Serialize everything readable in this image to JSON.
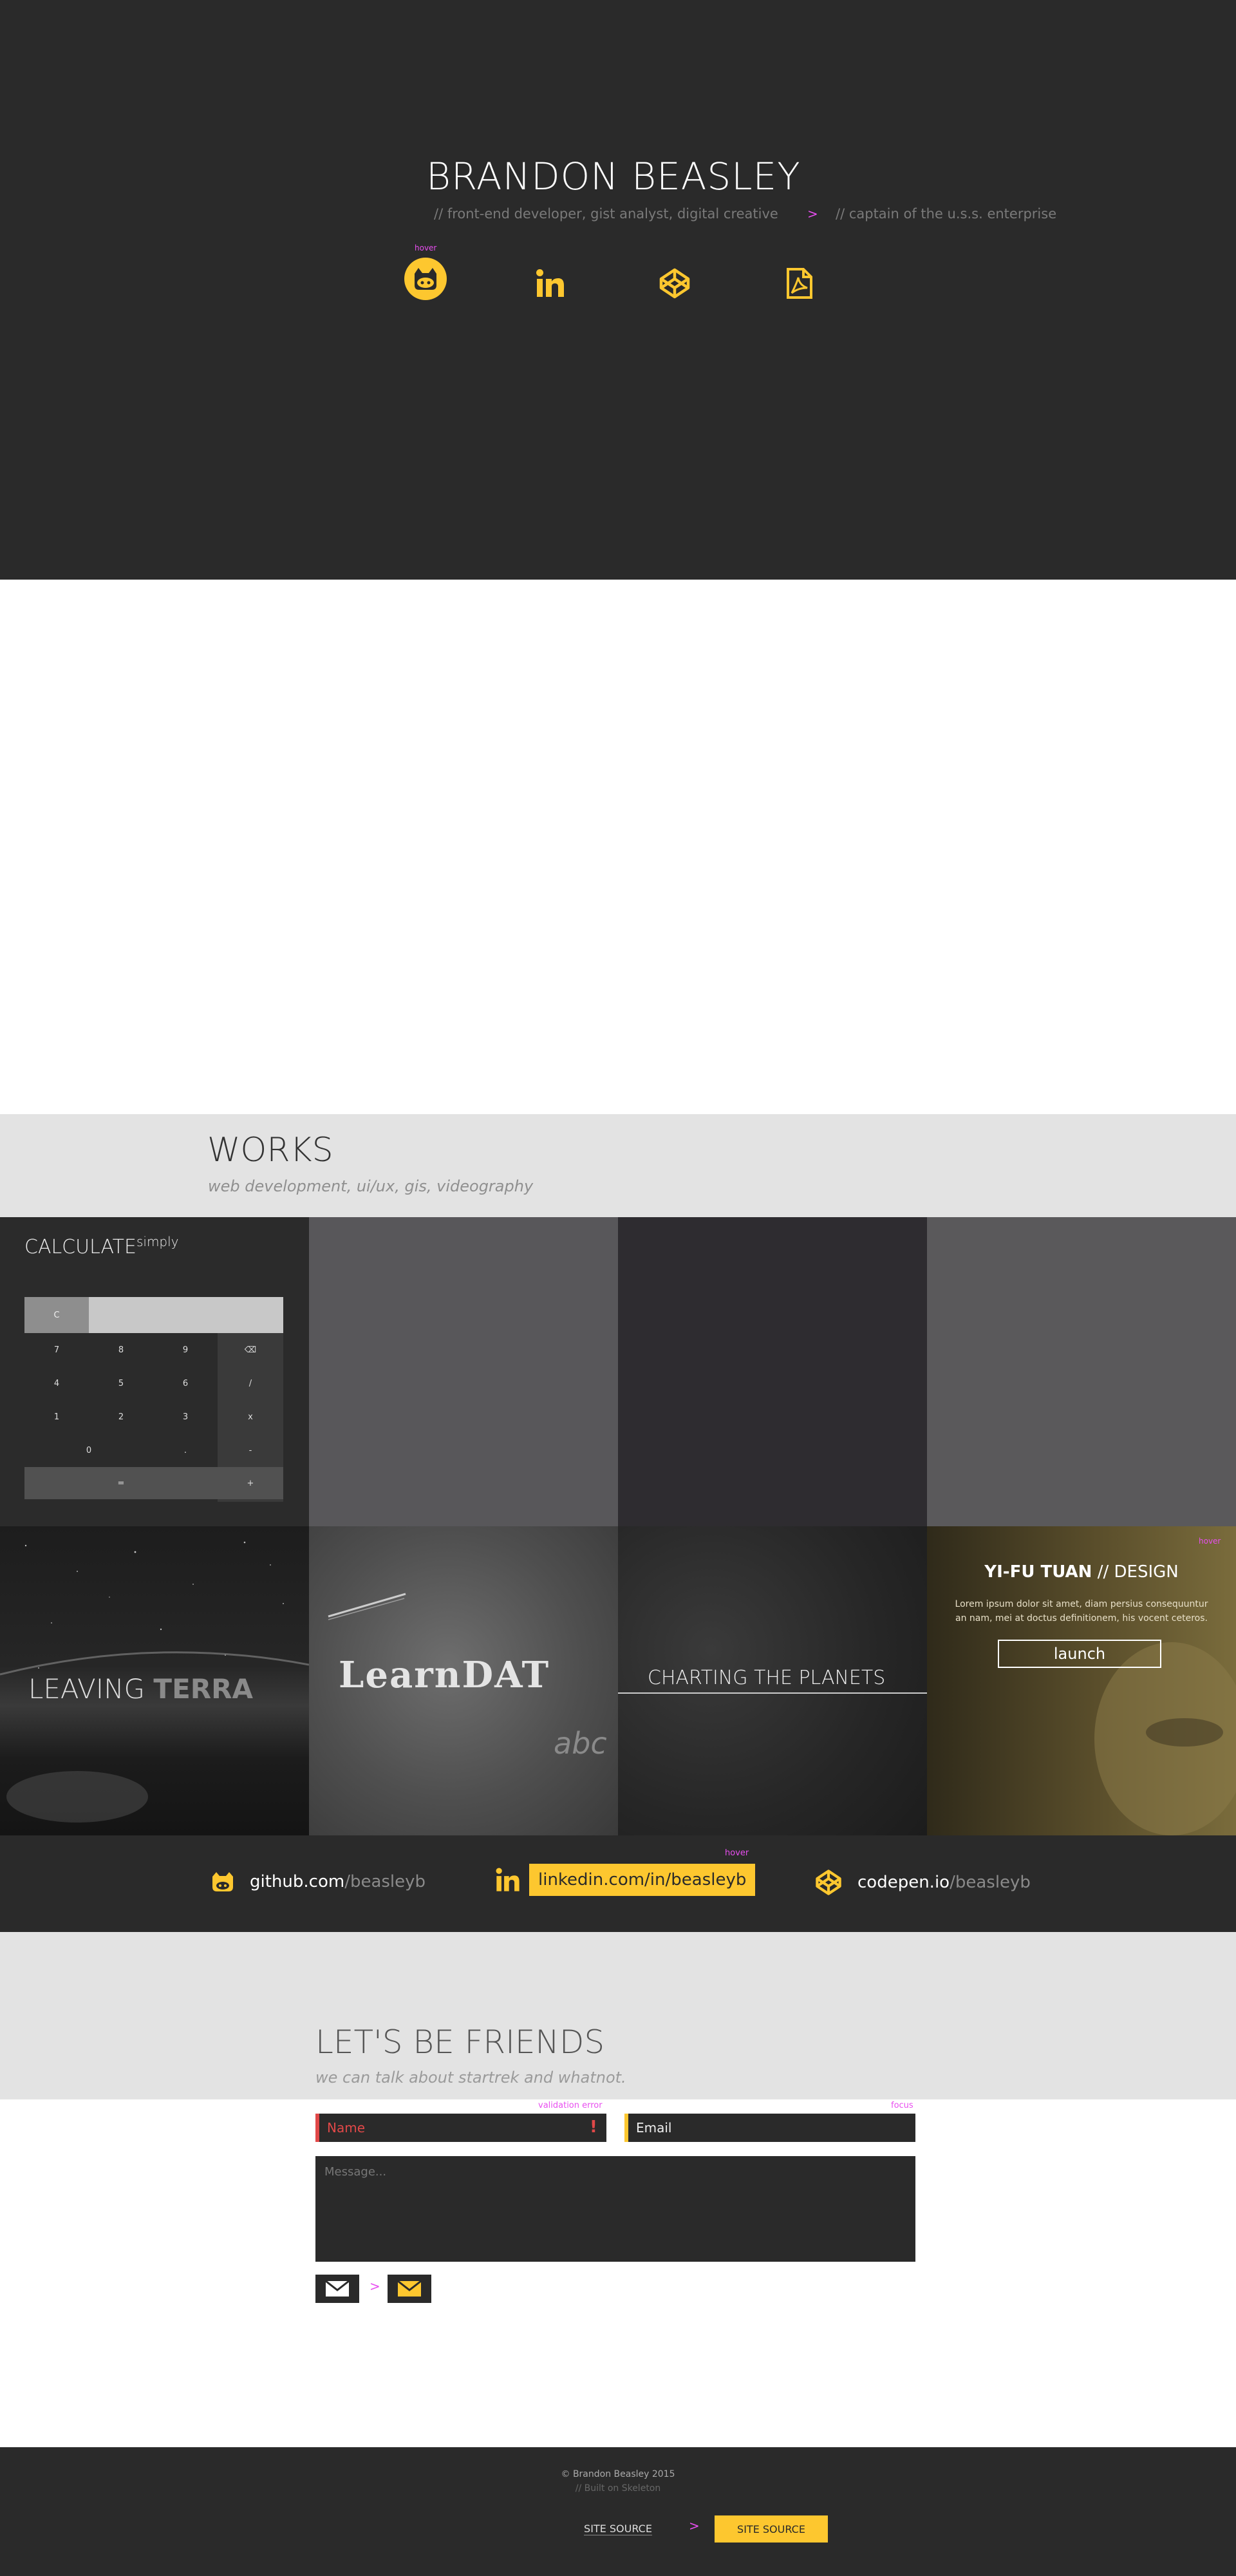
{
  "hero": {
    "name": "BRANDON BEASLEY",
    "tagline": "// front-end developer, gist analyst, digital creative",
    "arrow": ">",
    "tagline_alt": "// captain of the u.s.s. enterprise",
    "hover_note": "hover",
    "icons": [
      "github-icon",
      "linkedin-icon",
      "codepen-icon",
      "pdf-icon"
    ]
  },
  "works": {
    "title": "WORKS",
    "subtitle": "web development, ui/ux, gis, videography",
    "calculator": {
      "title": "CALCULATE",
      "title_sup": "simply",
      "clear": "C",
      "rows": [
        [
          "7",
          "8",
          "9",
          "⌫"
        ],
        [
          "4",
          "5",
          "6",
          "/"
        ],
        [
          "1",
          "2",
          "3",
          "x"
        ],
        [
          "0",
          ".",
          "-"
        ],
        [
          "=",
          "+"
        ]
      ]
    },
    "leaving": {
      "part1": "LEAVING ",
      "part2": "TERRA"
    },
    "learn": {
      "title": "LearnDAT",
      "chalk": "abc"
    },
    "planets": {
      "title": "CHARTING THE PLANETS"
    },
    "yifu": {
      "hover_note": "hover",
      "name": "YI-FU TUAN",
      "sep": " // ",
      "role": "DESIGN",
      "desc_line1": "Lorem ipsum dolor sit amet, diam persius consequuntur",
      "desc_line2": "an nam, mei at doctus definitionem, his vocent ceteros.",
      "button": "launch"
    }
  },
  "links": {
    "hover_note": "hover",
    "github": {
      "domain": "github.com",
      "path": "/beasleyb"
    },
    "linkedin": {
      "full": "linkedin.com/in/beasleyb"
    },
    "codepen": {
      "domain": "codepen.io",
      "path": "/beasleyb"
    }
  },
  "friends": {
    "title": "LET'S BE FRIENDS",
    "subtitle": "we can talk about startrek and whatnot.",
    "validation_note": "validation error",
    "focus_note": "focus",
    "name_placeholder": "Name",
    "email_placeholder": "Email",
    "message_placeholder": "Message...",
    "error_mark": "!",
    "arrow": ">"
  },
  "footer": {
    "copyright": "© Brandon Beasley 2015",
    "built": "// Built on Skeleton",
    "site_source": "SITE SOURCE",
    "site_source_hover": "SITE SOURCE",
    "arrow": ">"
  },
  "colors": {
    "accent": "#fdc72f",
    "dark": "#2a2a2a",
    "note": "#e84ef0",
    "error": "#e04848"
  }
}
